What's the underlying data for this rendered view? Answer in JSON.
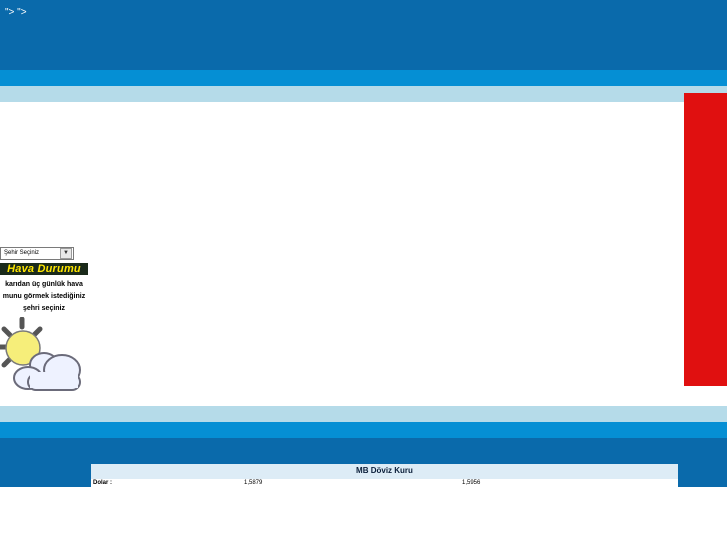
{
  "header": {
    "stray_text": "\"> \">"
  },
  "weather": {
    "select_value": "Şehir Seçiniz",
    "select_arrow": "▼",
    "title": "Hava Durumu",
    "lines": [
      "karıdan üç günlük hava",
      "munu görmek istediğiniz",
      "şehri seçiniz"
    ]
  },
  "currency": {
    "title": "MB Döviz Kuru",
    "rows": [
      {
        "label": "Dolar :",
        "buy": "1,5879",
        "sell": "1,5956"
      }
    ]
  },
  "colors": {
    "header_blue": "#0a6aab",
    "mid_blue": "#058fd4",
    "light_blue": "#b5dbe9",
    "red_panel": "#e01010"
  }
}
